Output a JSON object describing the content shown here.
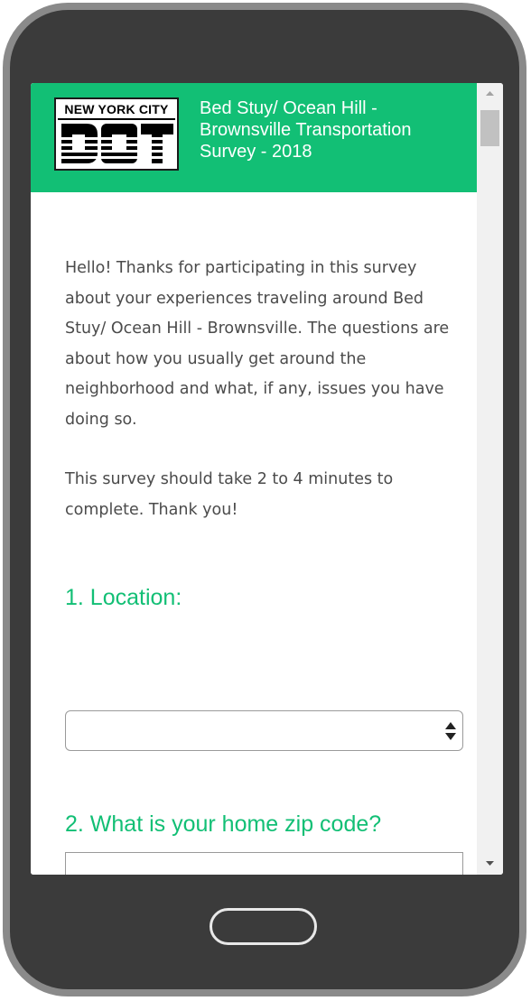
{
  "header": {
    "logo_text": "NEW YORK CITY",
    "logo_mark": "DOT",
    "title": "Bed Stuy/ Ocean Hill - Brownsville Transportation Survey - 2018",
    "background_color": "#12bf75"
  },
  "intro": {
    "paragraph_1": "Hello! Thanks for participating in this survey about your experiences traveling around Bed Stuy/ Ocean Hill - Brownsville. The questions are about how you usually get around the neighborhood and what, if any, issues you have doing so.",
    "paragraph_2": "This survey should take 2 to 4 minutes to complete. Thank you!"
  },
  "questions": [
    {
      "title": "1. Location:",
      "control": "select",
      "selected_value": ""
    },
    {
      "title": "2. What is your home zip code?",
      "control": "text-input",
      "value": ""
    }
  ],
  "icons": {
    "select_arrows": "sort-updown-icon",
    "scroll_up": "triangle-up-icon",
    "scroll_down": "triangle-down-icon"
  },
  "colors": {
    "accent": "#12bf75",
    "body_text": "#4b4b4b",
    "device_frame": "#3b3b3b"
  }
}
